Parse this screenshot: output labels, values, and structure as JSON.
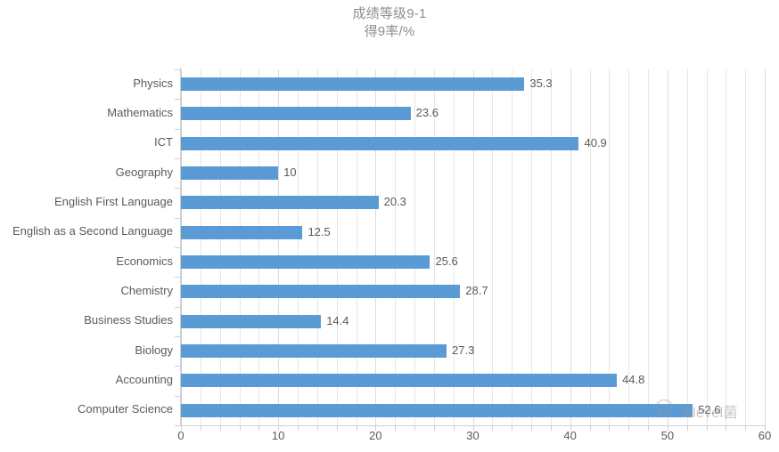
{
  "chart_data": {
    "type": "bar",
    "orientation": "horizontal",
    "title": "成绩等级9-1",
    "subtitle": "得9率/%",
    "xlabel": "",
    "ylabel": "",
    "xlim": [
      0,
      60
    ],
    "x_ticks": [
      0,
      10,
      20,
      30,
      40,
      50,
      60
    ],
    "minor_tick_step": 2,
    "grid": true,
    "legend": "none",
    "bar_color": "#5B9BD5",
    "categories": [
      "Physics",
      "Mathematics",
      "ICT",
      "Geography",
      "English First Language",
      "English as a Second Language",
      "Economics",
      "Chemistry",
      "Business Studies",
      "Biology",
      "Accounting",
      "Computer Science"
    ],
    "values": [
      35.3,
      23.6,
      40.9,
      10,
      20.3,
      12.5,
      25.6,
      28.7,
      14.4,
      27.3,
      44.8,
      52.6
    ],
    "value_labels": [
      "35.3",
      "23.6",
      "40.9",
      "10",
      "20.3",
      "12.5",
      "25.6",
      "28.7",
      "14.4",
      "27.3",
      "44.8",
      "52.6"
    ]
  },
  "watermark": {
    "text": "Alevel菌",
    "icon": "wechat-icon"
  }
}
